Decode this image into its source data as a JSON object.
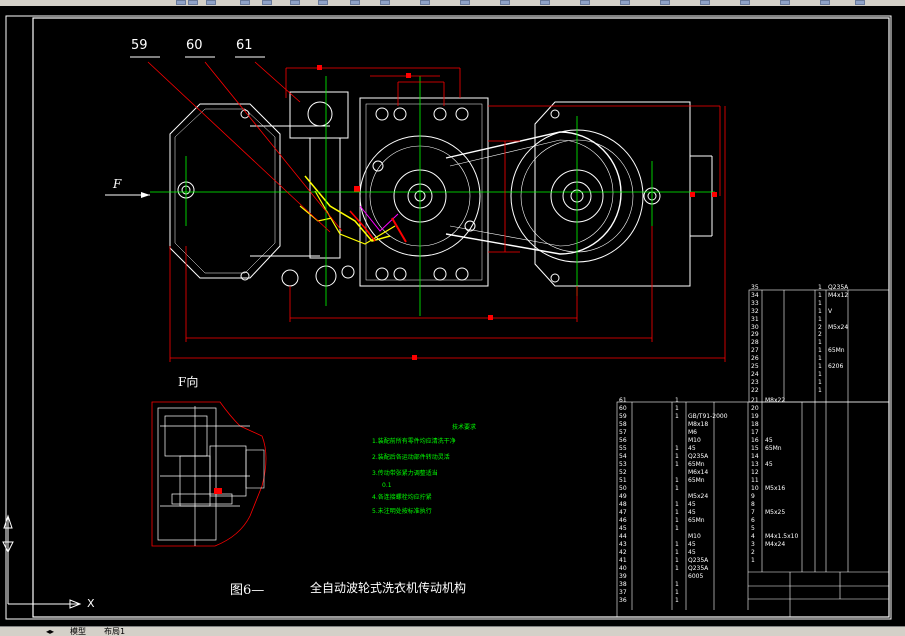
{
  "drawing": {
    "balloons": [
      "59",
      "60",
      "61"
    ],
    "force_label": "F",
    "view_label": "F向",
    "figure_number": "图6—",
    "figure_title": "全自动波轮式洗衣机传动机构",
    "tech_requirements": {
      "heading": "技术要求",
      "items": [
        "1.装配前所有零件均应清洗干净",
        "2.装配后各运动部件转动灵活",
        "3.传动带张紧力调整适当",
        "4.各连接螺栓均应拧紧",
        "5.未注明处按标准执行"
      ],
      "gap_value": "0.1"
    }
  },
  "bom_lower": {
    "rows": [
      {
        "no": "61",
        "qty": "1",
        "spec": ""
      },
      {
        "no": "60",
        "qty": "1",
        "spec": ""
      },
      {
        "no": "59",
        "qty": "1",
        "spec": "GB/T91-2000"
      },
      {
        "no": "58",
        "qty": "",
        "spec": "M8x18"
      },
      {
        "no": "57",
        "qty": "",
        "spec": "M6"
      },
      {
        "no": "56",
        "qty": "",
        "spec": "M10"
      },
      {
        "no": "55",
        "qty": "1",
        "spec": "45"
      },
      {
        "no": "54",
        "qty": "1",
        "spec": "Q235A"
      },
      {
        "no": "53",
        "qty": "1",
        "spec": "65Mn"
      },
      {
        "no": "52",
        "qty": "",
        "spec": "M6x14"
      },
      {
        "no": "51",
        "qty": "1",
        "spec": "65Mn"
      },
      {
        "no": "50",
        "qty": "1",
        "spec": ""
      },
      {
        "no": "49",
        "qty": "",
        "spec": "M5x24"
      },
      {
        "no": "48",
        "qty": "1",
        "spec": "45"
      },
      {
        "no": "47",
        "qty": "1",
        "spec": "45"
      },
      {
        "no": "46",
        "qty": "1",
        "spec": "65Mn"
      },
      {
        "no": "45",
        "qty": "1",
        "spec": ""
      },
      {
        "no": "44",
        "qty": "",
        "spec": "M10"
      },
      {
        "no": "43",
        "qty": "1",
        "spec": "45"
      },
      {
        "no": "42",
        "qty": "1",
        "spec": "45"
      },
      {
        "no": "41",
        "qty": "1",
        "spec": "Q235A"
      },
      {
        "no": "40",
        "qty": "1",
        "spec": "Q235A"
      },
      {
        "no": "39",
        "qty": "",
        "spec": "6005"
      },
      {
        "no": "38",
        "qty": "1",
        "spec": ""
      },
      {
        "no": "37",
        "qty": "1",
        "spec": ""
      },
      {
        "no": "36",
        "qty": "1",
        "spec": ""
      }
    ],
    "mid_rows": [
      {
        "no": "21",
        "spec": "M8x22"
      },
      {
        "no": "20",
        "spec": ""
      },
      {
        "no": "19",
        "spec": ""
      },
      {
        "no": "18",
        "spec": ""
      },
      {
        "no": "17",
        "spec": ""
      },
      {
        "no": "16",
        "spec": "45"
      },
      {
        "no": "15",
        "spec": "65Mn"
      },
      {
        "no": "14",
        "spec": ""
      },
      {
        "no": "13",
        "spec": "45"
      },
      {
        "no": "12",
        "spec": ""
      },
      {
        "no": "11",
        "spec": ""
      },
      {
        "no": "10",
        "spec": "M5x16"
      },
      {
        "no": "9",
        "spec": ""
      },
      {
        "no": "8",
        "spec": ""
      },
      {
        "no": "7",
        "spec": "M5x25"
      },
      {
        "no": "6",
        "spec": ""
      },
      {
        "no": "5",
        "spec": ""
      },
      {
        "no": "4",
        "spec": "M4x1.5x10"
      },
      {
        "no": "3",
        "spec": "M4x24"
      },
      {
        "no": "2",
        "spec": ""
      },
      {
        "no": "1",
        "spec": ""
      }
    ]
  },
  "bom_upper": {
    "rows": [
      {
        "no": "35",
        "qty": "1",
        "spec": "Q235A"
      },
      {
        "no": "34",
        "qty": "1",
        "spec": "M4x12"
      },
      {
        "no": "33",
        "qty": "1",
        "spec": ""
      },
      {
        "no": "32",
        "qty": "1",
        "spec": "V"
      },
      {
        "no": "31",
        "qty": "1",
        "spec": ""
      },
      {
        "no": "30",
        "qty": "2",
        "spec": "M5x24"
      },
      {
        "no": "29",
        "qty": "2",
        "spec": ""
      },
      {
        "no": "28",
        "qty": "1",
        "spec": ""
      },
      {
        "no": "27",
        "qty": "1",
        "spec": "65Mn"
      },
      {
        "no": "26",
        "qty": "1",
        "spec": ""
      },
      {
        "no": "25",
        "qty": "1",
        "spec": "6206"
      },
      {
        "no": "24",
        "qty": "1",
        "spec": ""
      },
      {
        "no": "23",
        "qty": "1",
        "spec": ""
      },
      {
        "no": "22",
        "qty": "1",
        "spec": ""
      }
    ]
  },
  "status": {
    "tab_model": "模型",
    "tab_layout": "布局1",
    "axis_label": "X"
  }
}
